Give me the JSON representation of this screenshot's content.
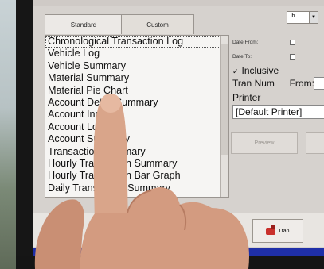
{
  "tabs": [
    {
      "label": "Standard"
    },
    {
      "label": "Custom"
    }
  ],
  "units_dropdown": {
    "value": "lb"
  },
  "report_list": {
    "items": [
      "Chronological Transaction Log",
      "Vehicle Log",
      "Vehicle Summary",
      "Material Summary",
      "Material Pie Chart",
      "Account Detail Summary",
      "Account Inquiry",
      "Account Log",
      "Account Summary",
      "Transaction Summary",
      "Hourly Transaction Summary",
      "Hourly Transaction Bar Graph",
      "Daily Transaction Summary"
    ]
  },
  "filters": {
    "date_from_label": "Date From:",
    "date_to_label": "Date To:",
    "inclusive_label": "Inclusive",
    "tran_num_label": "Tran Num",
    "from_label": "From:",
    "printer_label": "Printer",
    "printer_value": "[Default Printer]"
  },
  "actions": {
    "preview_label": "Preview",
    "tran_label": "Tran"
  },
  "colors": {
    "status_bar": "#1f2fa8",
    "screen_bg": "#d6d2ce"
  }
}
